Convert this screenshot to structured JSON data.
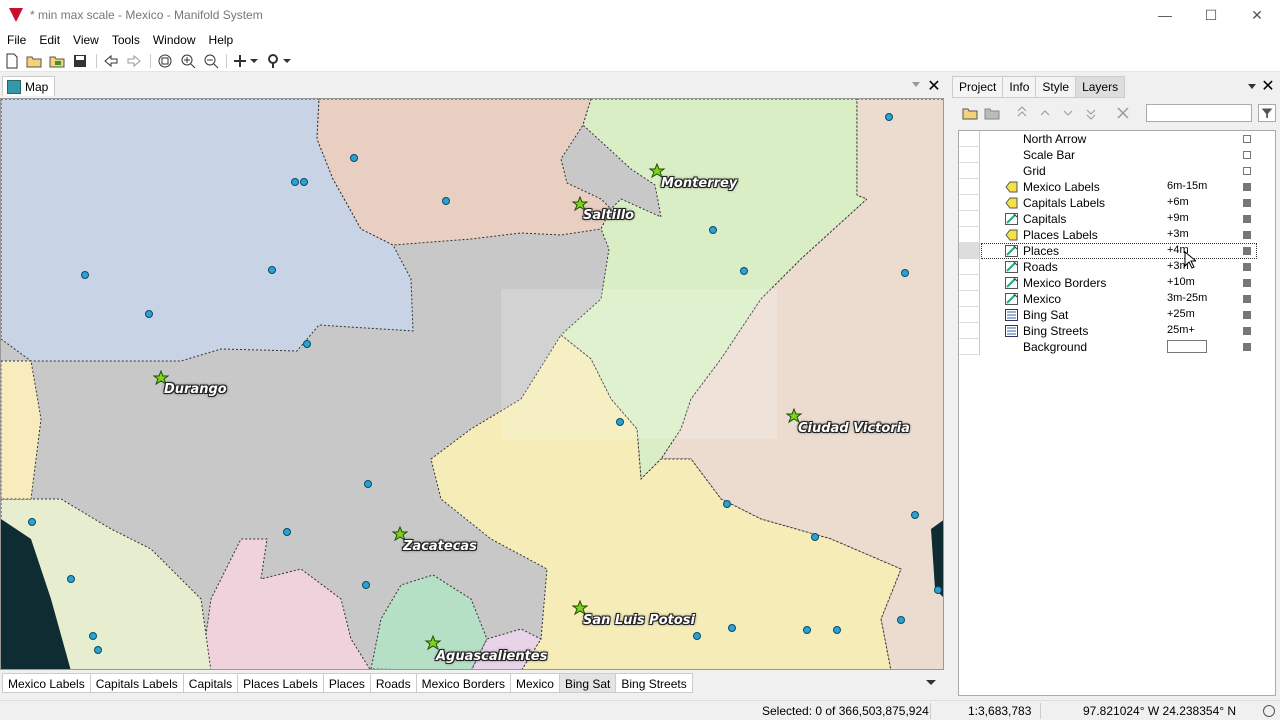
{
  "window": {
    "title": "* min max scale - Mexico - Manifold System",
    "minimize": "—",
    "maximize": "☐",
    "close": "✕"
  },
  "menu": [
    "File",
    "Edit",
    "View",
    "Tools",
    "Window",
    "Help"
  ],
  "map_pane": {
    "tab_label": "Map",
    "close": "✕",
    "city_labels": [
      "Monterrey",
      "Saltillo",
      "Durango",
      "Ciudad Victoria",
      "Zacatecas",
      "San Luis Potosi",
      "Aguascalientes"
    ],
    "layer_tabs": [
      "Mexico Labels",
      "Capitals Labels",
      "Capitals",
      "Places Labels",
      "Places",
      "Roads",
      "Mexico Borders",
      "Mexico",
      "Bing Sat",
      "Bing Streets"
    ],
    "active_layer_tab": "Bing Sat"
  },
  "right_pane": {
    "tabs": [
      "Project",
      "Info",
      "Style",
      "Layers"
    ],
    "active_tab": "Layers",
    "close": "✕",
    "filter_value": "",
    "layers": [
      {
        "name": "North Arrow",
        "scale": "",
        "icon": "none",
        "checked": false
      },
      {
        "name": "Scale Bar",
        "scale": "",
        "icon": "none",
        "checked": false
      },
      {
        "name": "Grid",
        "scale": "",
        "icon": "none",
        "checked": false
      },
      {
        "name": "Mexico Labels",
        "scale": "6m-15m",
        "icon": "labels-icon",
        "checked": true
      },
      {
        "name": "Capitals Labels",
        "scale": "+6m",
        "icon": "labels-icon",
        "checked": true
      },
      {
        "name": "Capitals",
        "scale": "+9m",
        "icon": "drawing-icon",
        "checked": true
      },
      {
        "name": "Places Labels",
        "scale": "+3m",
        "icon": "labels-icon",
        "checked": true
      },
      {
        "name": "Places",
        "scale": "+4m",
        "icon": "drawing-icon",
        "checked": true
      },
      {
        "name": "Roads",
        "scale": "+3m",
        "icon": "drawing-icon",
        "checked": true
      },
      {
        "name": "Mexico Borders",
        "scale": "+10m",
        "icon": "drawing-icon",
        "checked": true
      },
      {
        "name": "Mexico",
        "scale": "3m-25m",
        "icon": "drawing-icon",
        "checked": true
      },
      {
        "name": "Bing Sat",
        "scale": "+25m",
        "icon": "image-icon",
        "checked": true
      },
      {
        "name": "Bing Streets",
        "scale": "25m+",
        "icon": "image-icon",
        "checked": true
      },
      {
        "name": "Background",
        "scale": "",
        "icon": "none",
        "checked": true
      }
    ],
    "selected_layer": "Places"
  },
  "status": {
    "selected": "Selected: 0 of 366,503,875,924",
    "scale": "1:3,683,783",
    "coords": "97.821024° W 24.238354° N"
  },
  "colors": {
    "durango_region": "#c9d3e6",
    "coahuila_region": "#e8cfc2",
    "nuevo_leon_region": "#daeec6",
    "zacatecas_region": "#c8c8c8",
    "tamaulipas_region": "#ecdcd0",
    "slp_region": "#f6ecb8",
    "aguascalientes_region": "#b6e0c6",
    "jalisco_region": "#f0d2dc",
    "nayarit_region": "#e6eecf",
    "ocean": "#0e2c32",
    "capital_marker": "#7ed321",
    "place_marker": "#29a3d6"
  }
}
